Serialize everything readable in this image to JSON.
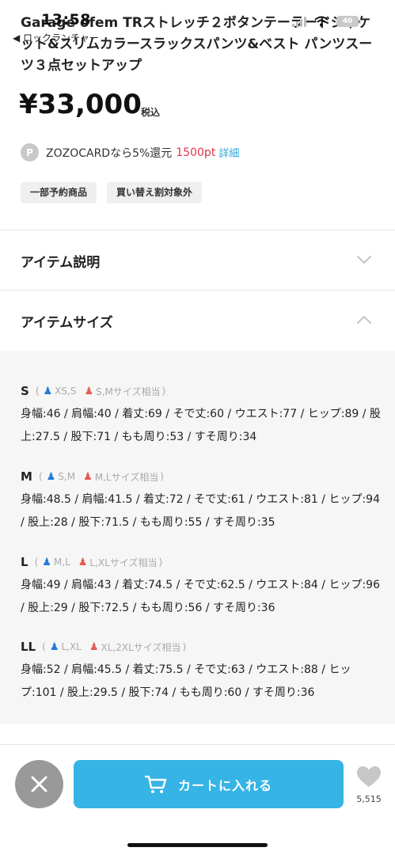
{
  "status_bar": {
    "time": "13:58",
    "back_app": "◀ ロックランチャー",
    "battery": "40"
  },
  "product": {
    "title": "Garage ofem TRストレッチ２ボタンテーラードジャケット&スリムカラースラックスパンツ&ベスト パンツスーツ３点セットアップ",
    "price": "¥33,000",
    "tax_label": "税込"
  },
  "points": {
    "icon_letter": "P",
    "text": "ZOZOCARDなら5%還元",
    "value": "1500pt",
    "detail_link": "詳細",
    "accent_color": "#e2334a",
    "link_color": "#2aa8d6"
  },
  "tags": [
    "一部予約商品",
    "買い替え割対象外"
  ],
  "sections": {
    "description": {
      "label": "アイテム説明",
      "state": "collapsed",
      "icon": "chevron-down-icon"
    },
    "size": {
      "label": "アイテムサイズ",
      "state": "expanded",
      "icon": "chevron-up-icon"
    }
  },
  "sizes": [
    {
      "name": "S",
      "men": "XS,S",
      "women": "S,Mサイズ相当",
      "measurements": "身幅:46 / 肩幅:40 / 着丈:69 / そで丈:60 / ウエスト:77 / ヒップ:89 / 股上:27.5 / 股下:71 / もも周り:53 / すそ周り:34"
    },
    {
      "name": "M",
      "men": "S,M",
      "women": "M,Lサイズ相当",
      "measurements": "身幅:48.5 / 肩幅:41.5 / 着丈:72 / そで丈:61 / ウエスト:81 / ヒップ:94 / 股上:28 / 股下:71.5 / もも周り:55 / すそ周り:35"
    },
    {
      "name": "L",
      "men": "M,L",
      "women": "L,XLサイズ相当",
      "measurements": "身幅:49 / 肩幅:43 / 着丈:74.5 / そで丈:62.5 / ウエスト:84 / ヒップ:96 / 股上:29 / 股下:72.5 / もも周り:56 / すそ周り:36"
    },
    {
      "name": "LL",
      "men": "L,XL",
      "women": "XL,2XLサイズ相当",
      "measurements": "身幅:52 / 肩幅:45.5 / 着丈:75.5 / そで丈:63 / ウエスト:88 / ヒップ:101 / 股上:29.5 / 股下:74 / もも周り:60 / すそ周り:36"
    }
  ],
  "bottom_bar": {
    "close_icon": "close-icon",
    "cart_label": "カートに入れる",
    "cart_icon": "cart-icon",
    "cart_color": "#35b4e5",
    "favorite_icon": "heart-icon",
    "favorite_count": "5,515"
  }
}
